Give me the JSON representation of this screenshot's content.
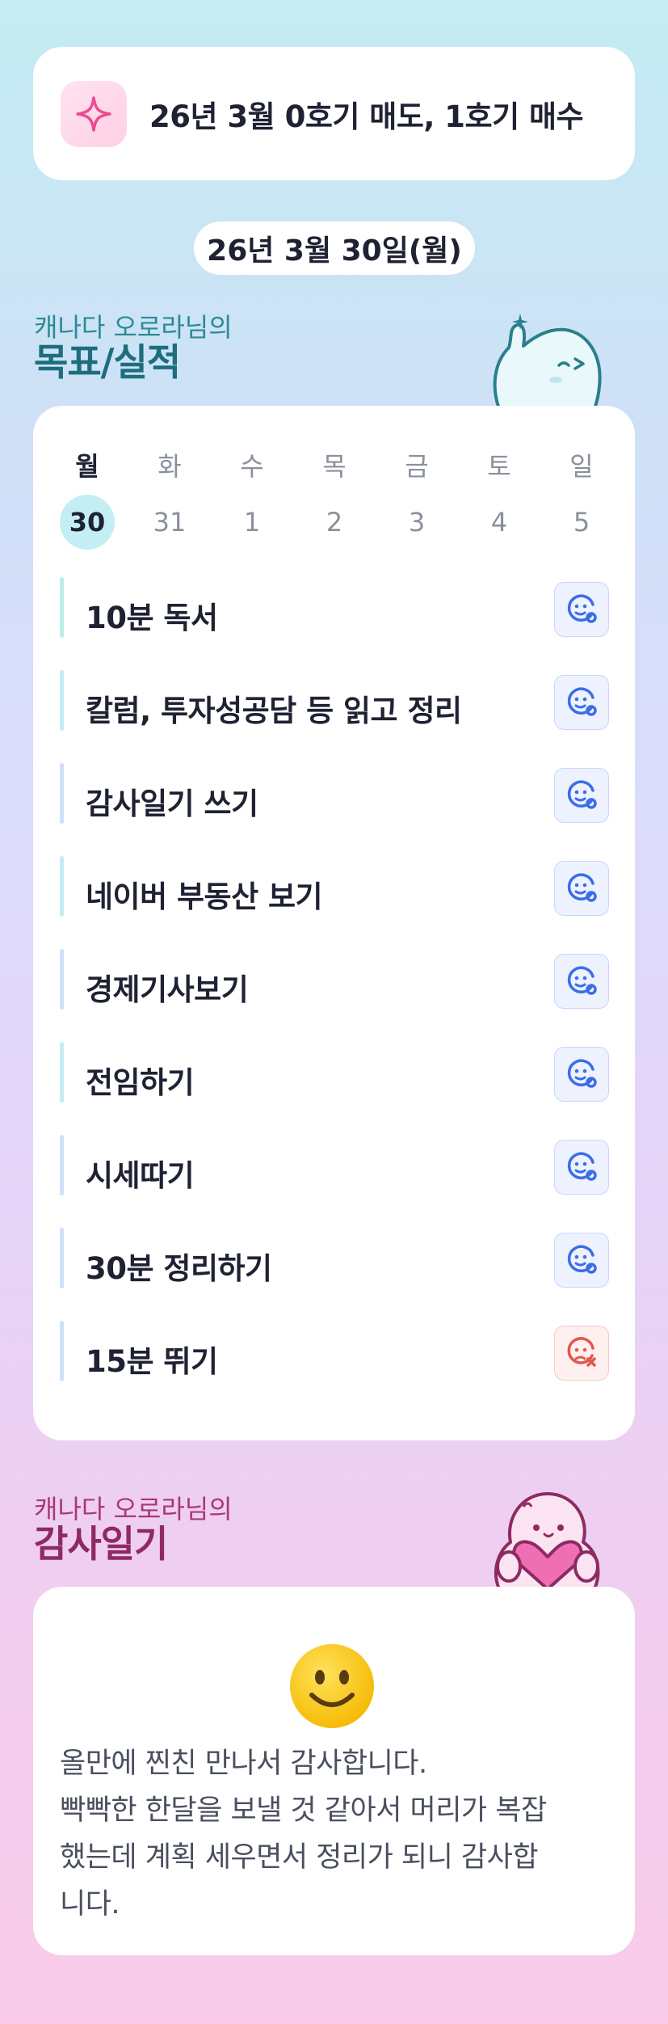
{
  "banner": {
    "icon": "sparkle-icon",
    "text": "26년 3월 0호기 매도, 1호기 매수"
  },
  "date": "26년 3월 30일(월)",
  "goals_section": {
    "subtitle": "캐나다 오로라님의",
    "title": "목표/실적"
  },
  "week": [
    {
      "name": "월",
      "num": "30",
      "active": true
    },
    {
      "name": "화",
      "num": "31",
      "active": false
    },
    {
      "name": "수",
      "num": "1",
      "active": false
    },
    {
      "name": "목",
      "num": "2",
      "active": false
    },
    {
      "name": "금",
      "num": "3",
      "active": false
    },
    {
      "name": "토",
      "num": "4",
      "active": false
    },
    {
      "name": "일",
      "num": "5",
      "active": false
    }
  ],
  "goals": [
    {
      "label": "10분 독서",
      "status": "done",
      "bar_color": "#bdeee6"
    },
    {
      "label": "칼럼, 투자성공담 등 읽고 정리",
      "status": "done",
      "bar_color": "#c5ecf3"
    },
    {
      "label": "감사일기 쓰기",
      "status": "done",
      "bar_color": "#cfe0f9"
    },
    {
      "label": "네이버 부동산 보기",
      "status": "done",
      "bar_color": "#c5ecf3"
    },
    {
      "label": "경제기사보기",
      "status": "done",
      "bar_color": "#cfe0f9"
    },
    {
      "label": "전임하기",
      "status": "done",
      "bar_color": "#c5ecf3"
    },
    {
      "label": "시세따기",
      "status": "done",
      "bar_color": "#cfe0f9"
    },
    {
      "label": "30분 정리하기",
      "status": "done",
      "bar_color": "#cfe0f9"
    },
    {
      "label": "15분 뛰기",
      "status": "failed",
      "bar_color": "#cfe0f9"
    }
  ],
  "diary_section": {
    "subtitle": "캐나다 오로라님의",
    "title": "감사일기"
  },
  "diary": {
    "emoji": "smiling-face-icon",
    "text": "올만에 찐친 만나서 감사합니다.\n빡빡한 한달을 보낼 것 같아서 머리가 복잡\n했는데 계획 세우면서 정리가 되니 감사합\n니다."
  },
  "colors": {
    "accent": "#1d6e7c",
    "diary_accent": "#8e2a63",
    "ok_icon": "#3a6ee8",
    "fail_icon": "#e2574c"
  }
}
